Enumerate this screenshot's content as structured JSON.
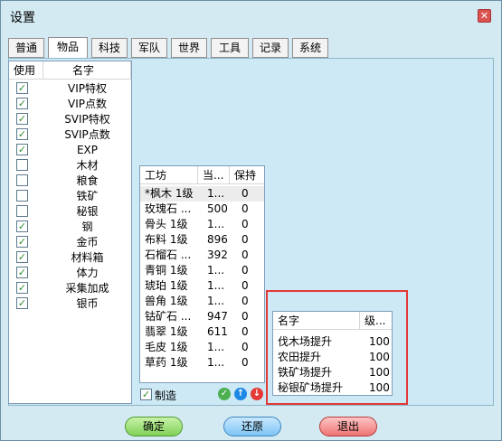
{
  "window": {
    "title": "设置"
  },
  "tabs": [
    "普通",
    "物品",
    "科技",
    "军队",
    "世界",
    "工具",
    "记录",
    "系统"
  ],
  "active_tab": "物品",
  "items_list": {
    "headers": [
      "使用",
      "名字"
    ],
    "rows": [
      {
        "checked": true,
        "name": "VIP特权"
      },
      {
        "checked": true,
        "name": "VIP点数"
      },
      {
        "checked": true,
        "name": "SVIP特权"
      },
      {
        "checked": true,
        "name": "SVIP点数"
      },
      {
        "checked": true,
        "name": "EXP"
      },
      {
        "checked": false,
        "name": "木材"
      },
      {
        "checked": false,
        "name": "粮食"
      },
      {
        "checked": false,
        "name": "铁矿"
      },
      {
        "checked": false,
        "name": "秘银"
      },
      {
        "checked": true,
        "name": "钢"
      },
      {
        "checked": true,
        "name": "金币"
      },
      {
        "checked": true,
        "name": "材料箱"
      },
      {
        "checked": true,
        "name": "体力"
      },
      {
        "checked": true,
        "name": "采集加成"
      },
      {
        "checked": true,
        "name": "银币"
      }
    ]
  },
  "workshop_list": {
    "headers": [
      "工坊",
      "当...",
      "保持"
    ],
    "rows": [
      [
        "*枫木 1级",
        "1...",
        "0"
      ],
      [
        "玫瑰石 ...",
        "500",
        "0"
      ],
      [
        "骨头 1级",
        "1...",
        "0"
      ],
      [
        "布料 1级",
        "896",
        "0"
      ],
      [
        "石榴石 ...",
        "392",
        "0"
      ],
      [
        "青铜 1级",
        "1...",
        "0"
      ],
      [
        "琥珀 1级",
        "1...",
        "0"
      ],
      [
        "兽角 1级",
        "1...",
        "0"
      ],
      [
        "钴矿石 ...",
        "947",
        "0"
      ],
      [
        "翡翠 1级",
        "611",
        "0"
      ],
      [
        "毛皮 1级",
        "1...",
        "0"
      ],
      [
        "草药 1级",
        "1...",
        "0"
      ]
    ],
    "make_label": "制造",
    "make_checked": true
  },
  "upgrade_list": {
    "headers": [
      "名字",
      "级..."
    ],
    "rows": [
      [
        "伐木场提升",
        "100"
      ],
      [
        "农田提升",
        "100"
      ],
      [
        "铁矿场提升",
        "100"
      ],
      [
        "秘银矿场提升",
        "100"
      ]
    ]
  },
  "buttons": {
    "ok": "确定",
    "reset": "还原",
    "exit": "退出"
  },
  "colors": {
    "accent_box": "#e53935"
  }
}
